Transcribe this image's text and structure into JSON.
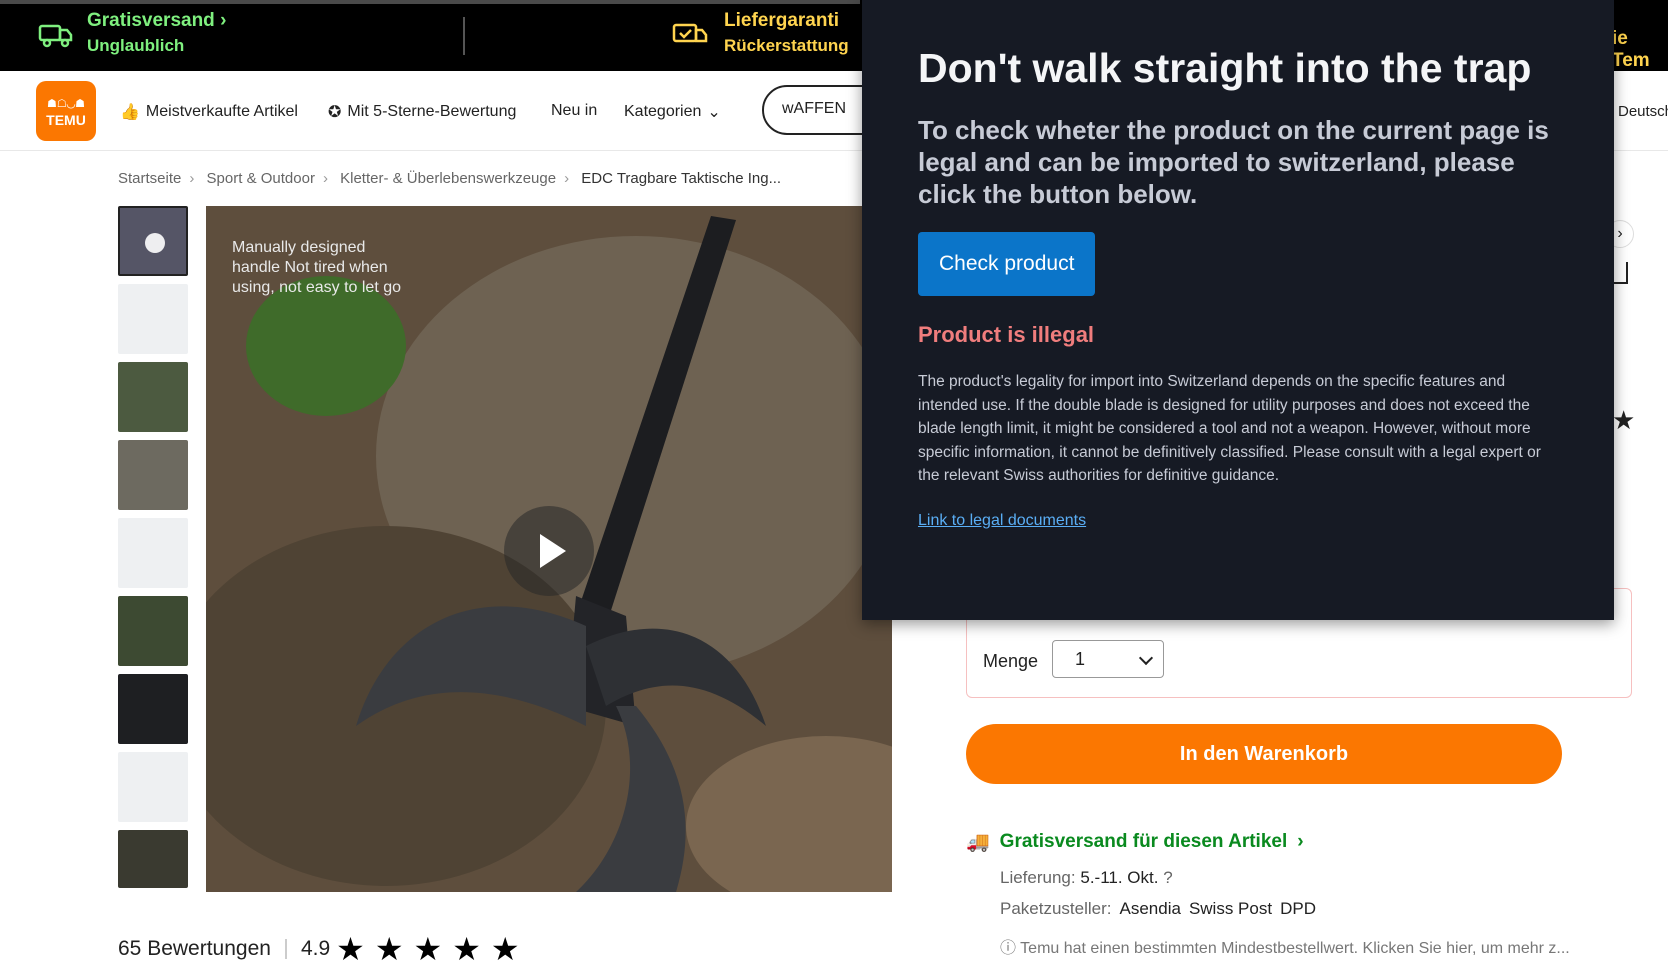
{
  "promo": {
    "item1_title": "Gratisversand",
    "item1_sub": "Unglaublich",
    "item2_title": "Liefergaranti",
    "item2_sub": "Rückerstattung",
    "item3_title": "ie Tem"
  },
  "nav": {
    "logo_text": "TEMU",
    "links": [
      "Meistverkaufte Artikel",
      "Mit 5-Sterne-Bewertung",
      "Neu in",
      "Kategorien"
    ],
    "search_value": "wAFFEN",
    "language": "Deutsch"
  },
  "breadcrumbs": [
    "Startseite",
    "Sport & Outdoor",
    "Kletter- & Überlebenswerkzeuge",
    "EDC Tragbare Taktische Ing..."
  ],
  "main_image": {
    "caption": "Manually designed handle Not tired when using, not easy to let go"
  },
  "ratings": {
    "count_label": "65 Bewertungen",
    "score": "4.9",
    "stars": "★★★★★"
  },
  "buy": {
    "qty_label": "Menge",
    "qty_value": "1",
    "cart_label": "In den Warenkorb",
    "shipping_label": "Gratisversand für diesen Artikel",
    "delivery_label": "Lieferung:",
    "delivery_value": "5.-11. Okt.",
    "carrier_label": "Paketzusteller:",
    "carriers": [
      "Asendia",
      "Swiss Post",
      "DPD"
    ],
    "note": "Temu hat einen bestimmten Mindestbestellwert. Klicken Sie hier, um mehr z..."
  },
  "overlay": {
    "title": "Don't walk straight into the trap",
    "subtitle": "To check wheter the product on the current page is legal and can be imported to switzerland, please click the button below.",
    "button_label": "Check product",
    "status": "Product is illegal",
    "description": "The product's legality for import into Switzerland depends on the specific features and intended use. If the double blade is designed for utility purposes and does not exceed the blade length limit, it might be considered a tool and not a weapon. However, without more specific information, it cannot be definitively classified. Please consult with a legal expert or the relevant Swiss authorities for definitive guidance.",
    "link_label": "Link to legal documents"
  },
  "colors": {
    "accent": "#fb7701",
    "overlay_bg": "#161a24",
    "button": "#0b75c9",
    "illegal": "#f07d7d",
    "green": "#0a8a1f"
  }
}
